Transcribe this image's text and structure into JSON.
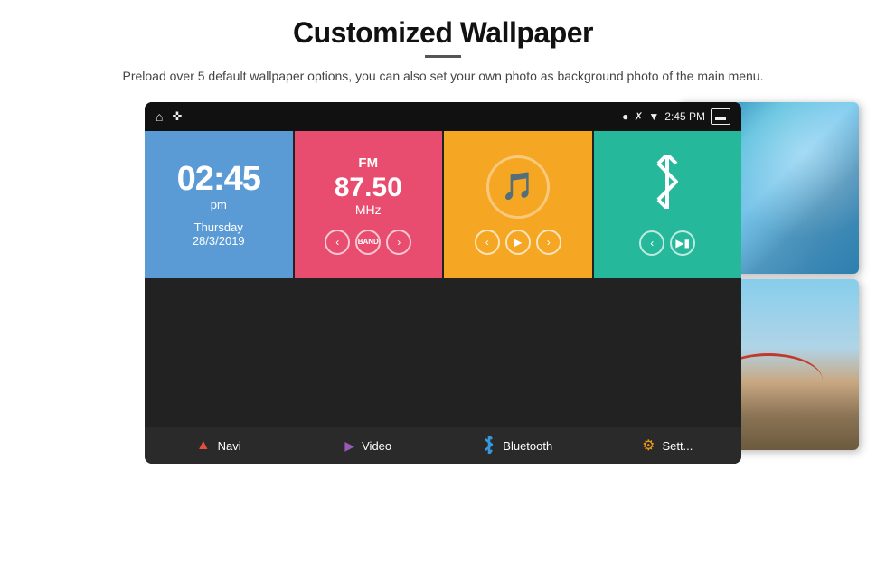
{
  "header": {
    "title": "Customized Wallpaper",
    "subtitle": "Preload over 5 default wallpaper options, you can also set your own photo as background photo of the main menu."
  },
  "device": {
    "status_bar": {
      "left_icons": [
        "home",
        "usb"
      ],
      "right_icons": [
        "location",
        "bluetooth",
        "wifi",
        "time",
        "battery"
      ],
      "time": "2:45 PM"
    },
    "tiles": {
      "clock": {
        "time": "02:45",
        "ampm": "pm",
        "day": "Thursday",
        "date": "28/3/2019"
      },
      "fm": {
        "label": "FM",
        "frequency": "87.50",
        "unit": "MHz"
      },
      "music": {
        "icon": "♪"
      },
      "bluetooth": {}
    },
    "nav_items": [
      {
        "icon": "navi",
        "label": "Navi"
      },
      {
        "icon": "video",
        "label": "Video"
      },
      {
        "icon": "bluetooth",
        "label": "Bluetooth"
      },
      {
        "icon": "settings",
        "label": "Sett..."
      }
    ],
    "dots": [
      false,
      true,
      false,
      false,
      false
    ]
  }
}
